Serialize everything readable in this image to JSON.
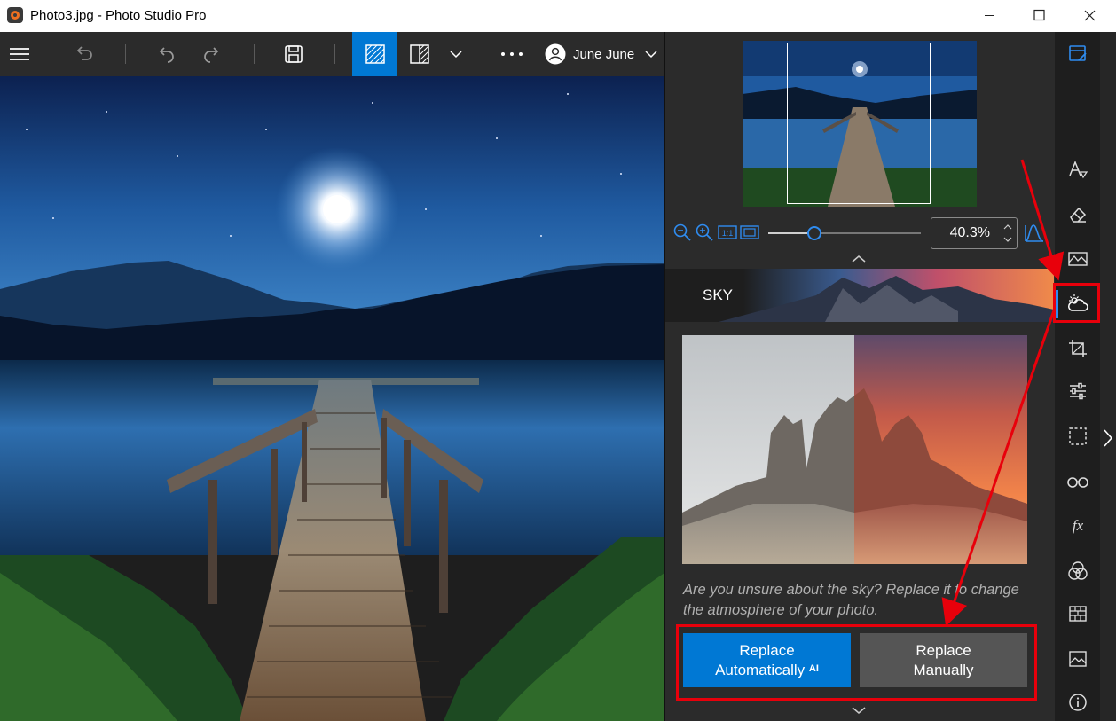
{
  "window": {
    "title": "Photo3.jpg - Photo Studio Pro",
    "controls": [
      "minimize",
      "maximize",
      "close"
    ]
  },
  "toolbar": {
    "items": [
      "menu-icon",
      "undo-all-icon",
      "undo-icon",
      "redo-icon",
      "save-icon",
      "view-single-icon",
      "view-split-icon",
      "chevron-down-icon",
      "more-icon"
    ],
    "user": {
      "name": "June June"
    },
    "active_view": "view-single"
  },
  "navigator": {
    "zoom_value": "40.3%",
    "zoom_slider_fraction": 0.3
  },
  "sky_panel": {
    "title": "SKY",
    "description": "Are you unsure about the sky? Replace it to change the atmosphere of your photo.",
    "buttons": {
      "replace_auto_line1": "Replace",
      "replace_auto_line2": "Automatically",
      "replace_auto_badge": "AI",
      "replace_manual_line1": "Replace",
      "replace_manual_line2": "Manually"
    }
  },
  "sidebar": {
    "tools": [
      "edit-notes",
      "text-style",
      "eraser",
      "panorama",
      "sky",
      "crop",
      "adjustments",
      "selection",
      "glasses",
      "fx",
      "color-circles",
      "texture",
      "image",
      "info"
    ],
    "active_tool": "sky"
  },
  "colors": {
    "accent": "#0078d4",
    "annotation": "#e8000b",
    "panel": "#2b2b2b",
    "sidebar": "#1e1e1e"
  }
}
